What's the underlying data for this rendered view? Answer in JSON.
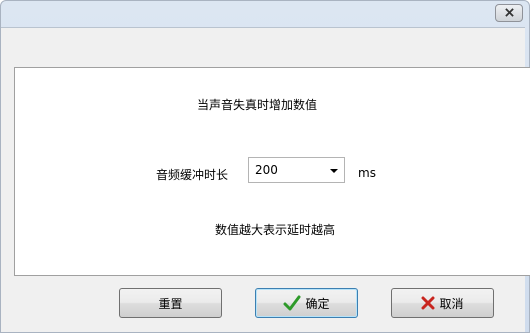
{
  "content": {
    "heading": "当声音失真时增加数值",
    "buffer_label": "音频缓冲时长",
    "buffer_value": "200",
    "unit": "ms",
    "hint": "数值越大表示延时越高"
  },
  "buttons": {
    "reset": "重置",
    "ok": "确定",
    "cancel": "取消"
  },
  "icons": {
    "close": "close-icon",
    "ok": "checkmark-icon",
    "cancel": "red-x-icon"
  },
  "colors": {
    "check": "#2e9a2a",
    "cancel_x": "#c8251f",
    "titlebar": "#dce6f2"
  }
}
